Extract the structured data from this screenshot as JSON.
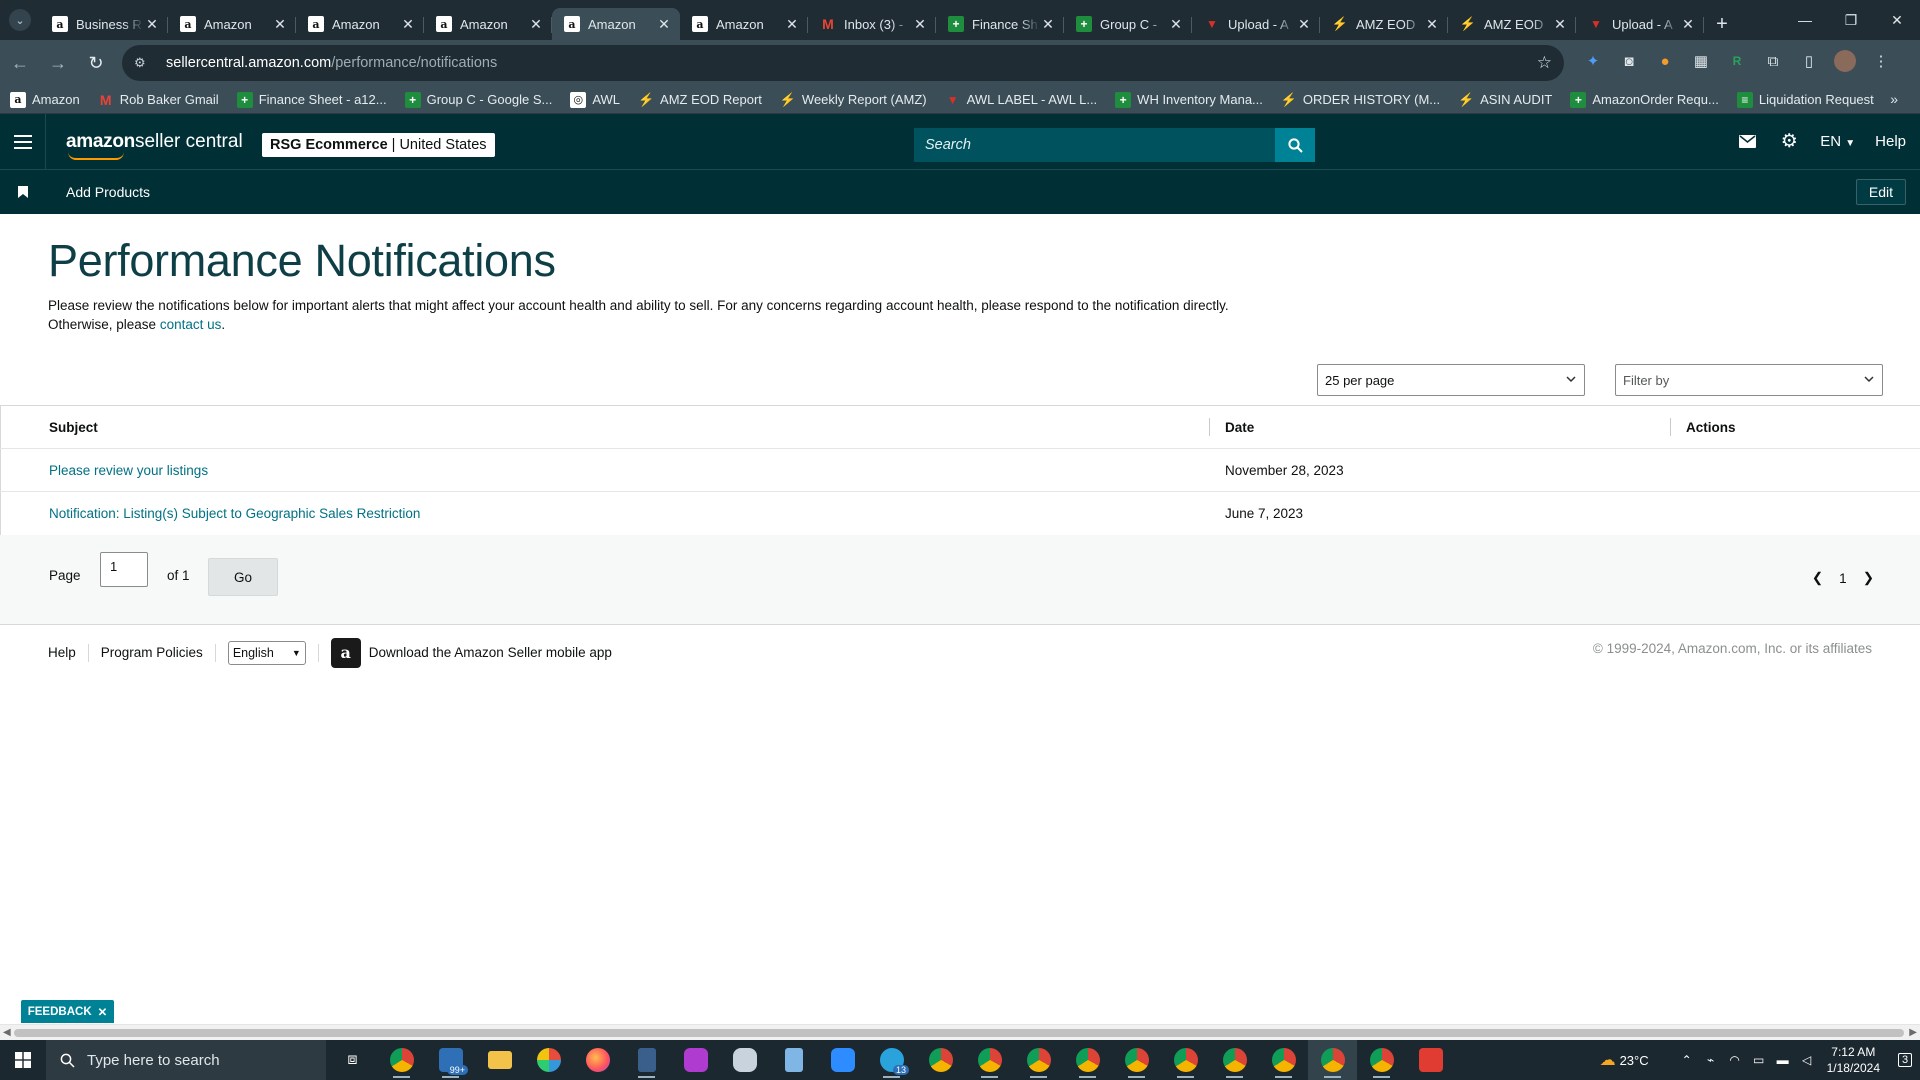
{
  "browser": {
    "tabs": [
      {
        "title": "Business R",
        "favicon": "amazon-icon",
        "active": false,
        "fade": true
      },
      {
        "title": "Amazon",
        "favicon": "amazon-icon",
        "active": false,
        "fade": false
      },
      {
        "title": "Amazon",
        "favicon": "amazon-icon",
        "active": false,
        "fade": false
      },
      {
        "title": "Amazon",
        "favicon": "amazon-icon",
        "active": false,
        "fade": false
      },
      {
        "title": "Amazon",
        "favicon": "amazon-icon",
        "active": true,
        "fade": false
      },
      {
        "title": "Amazon",
        "favicon": "amazon-icon",
        "active": false,
        "fade": false
      },
      {
        "title": "Inbox (3) -",
        "favicon": "gmail-icon",
        "active": false,
        "fade": true
      },
      {
        "title": "Finance Sh",
        "favicon": "sheets-icon",
        "active": false,
        "fade": true
      },
      {
        "title": "Group C - ",
        "favicon": "sheets-icon",
        "active": false,
        "fade": true
      },
      {
        "title": "Upload - A",
        "favicon": "upload-icon",
        "active": false,
        "fade": true
      },
      {
        "title": "AMZ EOD",
        "favicon": "amz-eod-icon",
        "active": false,
        "fade": true
      },
      {
        "title": "AMZ EOD",
        "favicon": "amz-eod-icon",
        "active": false,
        "fade": true
      },
      {
        "title": "Upload - A",
        "favicon": "upload-icon",
        "active": false,
        "fade": true
      }
    ],
    "url_host": "sellercentral.amazon.com",
    "url_path": "/performance/notifications",
    "bookmarks": [
      {
        "label": "Amazon",
        "favicon": "amazon-icon"
      },
      {
        "label": "Rob Baker Gmail",
        "favicon": "gmail-icon"
      },
      {
        "label": "Finance Sheet - a12...",
        "favicon": "sheets-icon"
      },
      {
        "label": "Group C - Google S...",
        "favicon": "sheets-icon"
      },
      {
        "label": "AWL",
        "favicon": "awl-icon"
      },
      {
        "label": "AMZ EOD Report",
        "favicon": "amz-eod-icon"
      },
      {
        "label": "Weekly Report (AMZ)",
        "favicon": "amz-eod-icon"
      },
      {
        "label": "AWL LABEL - AWL L...",
        "favicon": "upload-icon"
      },
      {
        "label": "WH Inventory Mana...",
        "favicon": "sheets-icon"
      },
      {
        "label": "ORDER HISTORY (M...",
        "favicon": "amz-eod-icon"
      },
      {
        "label": "ASIN AUDIT",
        "favicon": "amz-eod-icon"
      },
      {
        "label": "AmazonOrder Requ...",
        "favicon": "sheets-icon"
      },
      {
        "label": "Liquidation Request",
        "favicon": "forms-icon"
      }
    ]
  },
  "header": {
    "logo_amazon": "amazon",
    "logo_rest": " seller central",
    "store_name": "RSG Ecommerce",
    "store_sep": "|",
    "marketplace": "United States",
    "search_placeholder": "Search",
    "language": "EN",
    "help": "Help"
  },
  "subnav": {
    "link": "Add Products",
    "edit": "Edit"
  },
  "page": {
    "title": "Performance Notifications",
    "intro_text": "Please review the notifications below for important alerts that might affect your account health and ability to sell. For any concerns regarding account health, please respond to the notification directly. Otherwise, please ",
    "intro_link": "contact us",
    "intro_end": ".",
    "per_page": "25 per page",
    "filter_placeholder": "Filter by"
  },
  "table": {
    "columns": {
      "subject": "Subject",
      "date": "Date",
      "actions": "Actions"
    },
    "rows": [
      {
        "subject": "Please review your listings",
        "date": "November 28, 2023"
      },
      {
        "subject": "Notification: Listing(s) Subject to Geographic Sales Restriction",
        "date": "June 7, 2023"
      }
    ]
  },
  "pager": {
    "page_label": "Page",
    "page_value": "1",
    "of_label": "of 1",
    "go": "Go",
    "current": "1"
  },
  "footer": {
    "help": "Help",
    "policies": "Program Policies",
    "language": "English",
    "app_text": "Download the Amazon Seller mobile app",
    "copyright": "© 1999-2024, Amazon.com, Inc. or its affiliates"
  },
  "feedback": "FEEDBACK",
  "taskbar": {
    "search_placeholder": "Type here to search",
    "mail_badge": "99+",
    "telegram_badge": "13",
    "weather": "23°C",
    "time": "7:12 AM",
    "date": "1/18/2024",
    "notif_count": "3"
  },
  "colors": {
    "header_bg": "#002f36",
    "link": "#007185",
    "title": "#0f3f46",
    "search_btn": "#008296"
  }
}
